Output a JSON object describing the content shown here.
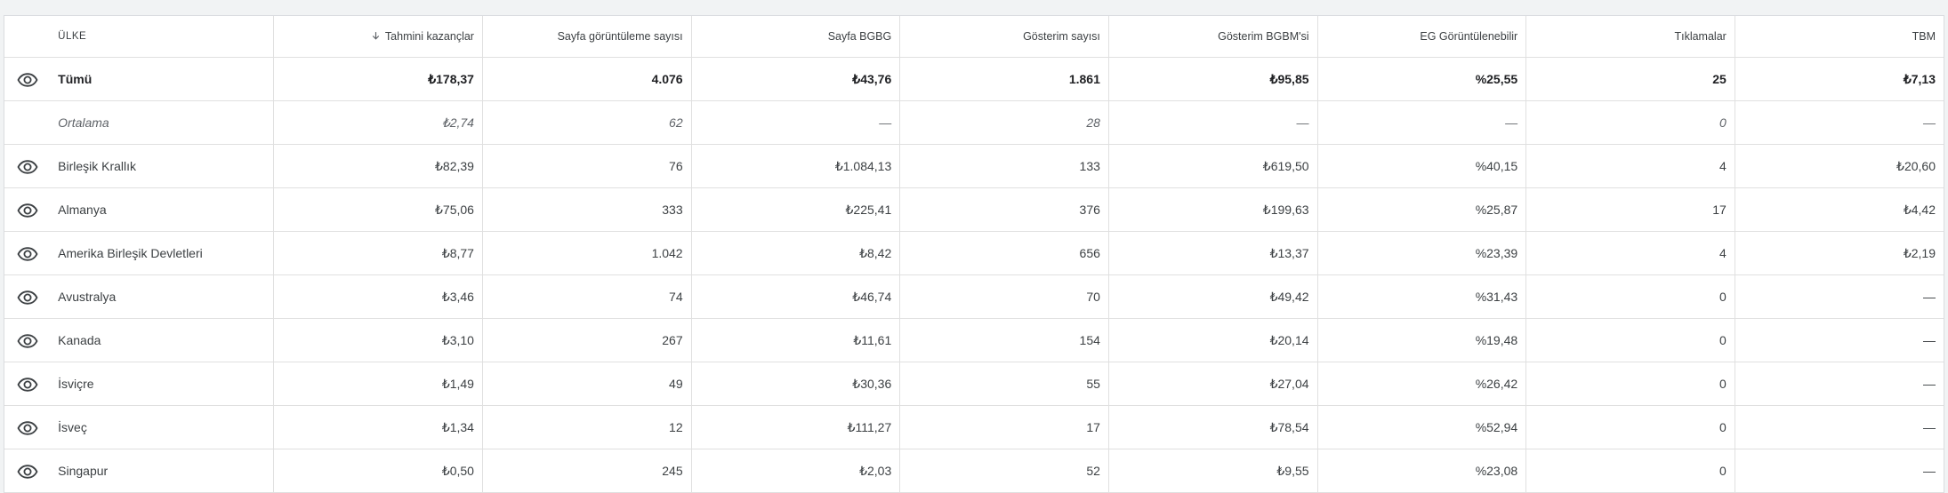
{
  "table": {
    "headers": {
      "country": "ÜLKE",
      "earnings": "Tahmini kazançlar",
      "pageviews": "Sayfa görüntüleme sayısı",
      "page_rpm": "Sayfa BGBG",
      "impressions": "Gösterim sayısı",
      "impression_rpm": "Gösterim BGBM'si",
      "viewable": "EG Görüntülenebilir",
      "clicks": "Tıklamalar",
      "cpc": "TBM"
    },
    "sort_icon": "arrow-down-icon",
    "visibility_icon": "eye-icon",
    "total": {
      "country": "Tümü",
      "earnings": "₺178,37",
      "pageviews": "4.076",
      "page_rpm": "₺43,76",
      "impressions": "1.861",
      "impression_rpm": "₺95,85",
      "viewable": "%25,55",
      "clicks": "25",
      "cpc": "₺7,13"
    },
    "average": {
      "country": "Ortalama",
      "earnings": "₺2,74",
      "pageviews": "62",
      "page_rpm": "—",
      "impressions": "28",
      "impression_rpm": "—",
      "viewable": "—",
      "clicks": "0",
      "cpc": "—"
    },
    "rows": [
      {
        "country": "Birleşik Krallık",
        "earnings": "₺82,39",
        "pageviews": "76",
        "page_rpm": "₺1.084,13",
        "impressions": "133",
        "impression_rpm": "₺619,50",
        "viewable": "%40,15",
        "clicks": "4",
        "cpc": "₺20,60"
      },
      {
        "country": "Almanya",
        "earnings": "₺75,06",
        "pageviews": "333",
        "page_rpm": "₺225,41",
        "impressions": "376",
        "impression_rpm": "₺199,63",
        "viewable": "%25,87",
        "clicks": "17",
        "cpc": "₺4,42"
      },
      {
        "country": "Amerika Birleşik Devletleri",
        "earnings": "₺8,77",
        "pageviews": "1.042",
        "page_rpm": "₺8,42",
        "impressions": "656",
        "impression_rpm": "₺13,37",
        "viewable": "%23,39",
        "clicks": "4",
        "cpc": "₺2,19"
      },
      {
        "country": "Avustralya",
        "earnings": "₺3,46",
        "pageviews": "74",
        "page_rpm": "₺46,74",
        "impressions": "70",
        "impression_rpm": "₺49,42",
        "viewable": "%31,43",
        "clicks": "0",
        "cpc": "—"
      },
      {
        "country": "Kanada",
        "earnings": "₺3,10",
        "pageviews": "267",
        "page_rpm": "₺11,61",
        "impressions": "154",
        "impression_rpm": "₺20,14",
        "viewable": "%19,48",
        "clicks": "0",
        "cpc": "—"
      },
      {
        "country": "İsviçre",
        "earnings": "₺1,49",
        "pageviews": "49",
        "page_rpm": "₺30,36",
        "impressions": "55",
        "impression_rpm": "₺27,04",
        "viewable": "%26,42",
        "clicks": "0",
        "cpc": "—"
      },
      {
        "country": "İsveç",
        "earnings": "₺1,34",
        "pageviews": "12",
        "page_rpm": "₺111,27",
        "impressions": "17",
        "impression_rpm": "₺78,54",
        "viewable": "%52,94",
        "clicks": "0",
        "cpc": "—"
      },
      {
        "country": "Singapur",
        "earnings": "₺0,50",
        "pageviews": "245",
        "page_rpm": "₺2,03",
        "impressions": "52",
        "impression_rpm": "₺9,55",
        "viewable": "%23,08",
        "clicks": "0",
        "cpc": "—"
      }
    ]
  },
  "colors": {
    "text": "#3c4043",
    "border": "#e0e0e0",
    "page_bg": "#f1f3f4"
  }
}
